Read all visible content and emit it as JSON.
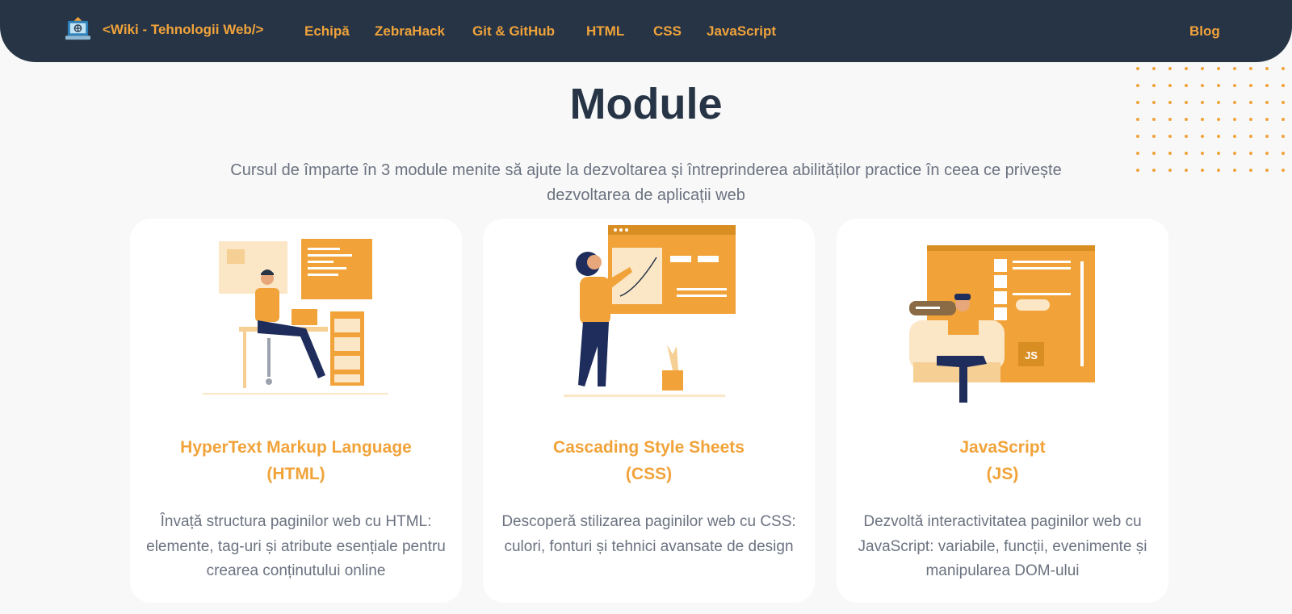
{
  "brand": {
    "name": "<Wiki - Tehnologii Web/>"
  },
  "nav": {
    "echipa": "Echipă",
    "zebrahack": "ZebraHack",
    "git": "Git & GitHub",
    "html": "HTML",
    "css": "CSS",
    "javascript": "JavaScript",
    "blog": "Blog"
  },
  "page": {
    "title": "Module",
    "subtitle": "Cursul de împarte în 3 module menite să ajute la dezvoltarea și întreprinderea abilităților practice în ceea ce privește dezvoltarea de aplicații web"
  },
  "cards": [
    {
      "title_line1": "HyperText Markup Language",
      "title_line2": "(HTML)",
      "desc": "Învață structura paginilor web cu HTML: elemente, tag-uri și atribute esențiale pentru crearea conținutului online"
    },
    {
      "title_line1": "Cascading Style Sheets",
      "title_line2": "(CSS)",
      "desc": "Descoperă stilizarea paginilor web cu CSS: culori, fonturi și tehnici avansate de design"
    },
    {
      "title_line1": "JavaScript",
      "title_line2": "(JS)",
      "desc": "Dezvoltă interactivitatea paginilor web cu JavaScript: variabile, funcții, evenimente și manipularea DOM-ului",
      "badge": "JS"
    }
  ],
  "colors": {
    "navy": "#263446",
    "accent": "#f1a33a",
    "text_muted": "#6b7280",
    "page_bg": "#f8f8f8"
  }
}
